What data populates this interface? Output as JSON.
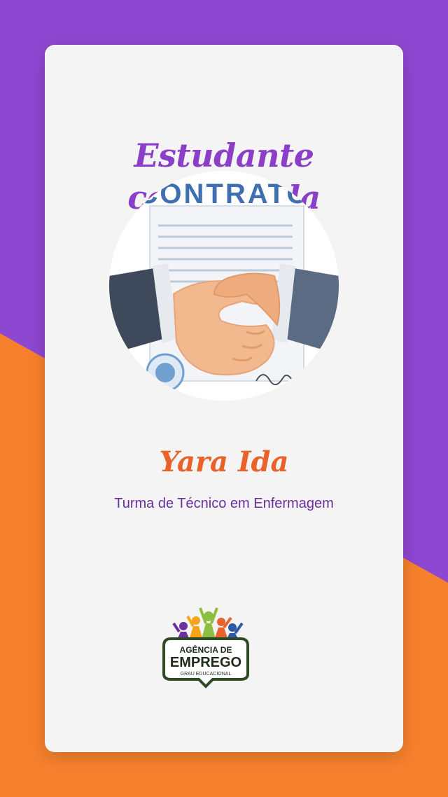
{
  "colors": {
    "background_top": "#8e47d1",
    "background_bottom": "#f6802d",
    "card": "#f4f4f4",
    "headline": "#8b3fc8",
    "name": "#e8622a",
    "course": "#6b2f9e"
  },
  "headline": "Estudante contratada",
  "photo": {
    "document_title": "CONTRATO",
    "icon": "handshake-contract-image"
  },
  "student": {
    "name": "Yara Ida",
    "course": "Turma de Técnico em Enfermagem"
  },
  "logo": {
    "line1": "AGÊNCIA DE",
    "line2": "EMPREGO",
    "line3": "GRAU EDUCACIONAL"
  }
}
